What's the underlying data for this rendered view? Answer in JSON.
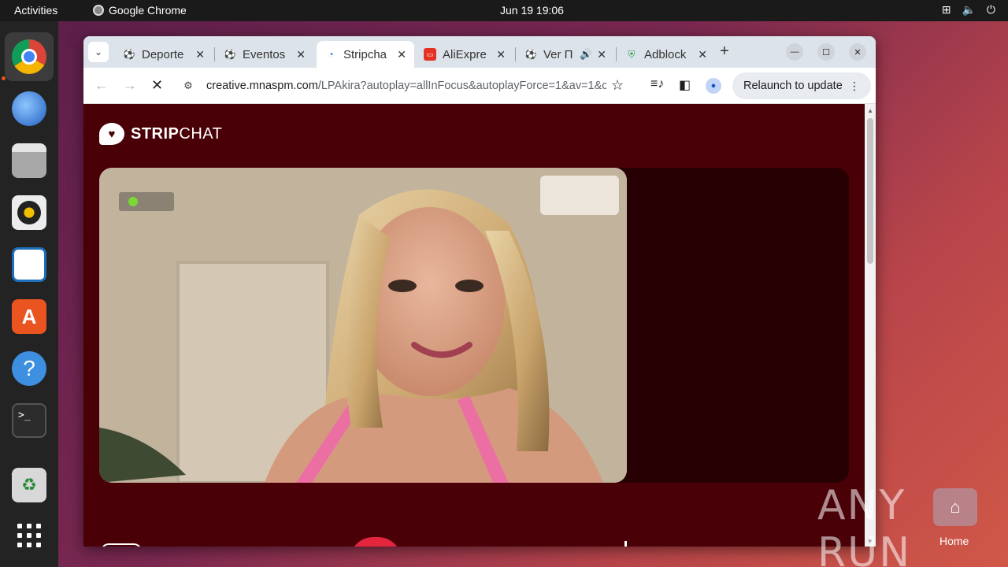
{
  "topbar": {
    "activities": "Activities",
    "app_name": "Google Chrome",
    "datetime": "Jun 19  19:06"
  },
  "tabs": [
    {
      "title": "Deporte",
      "favicon": "soccer-ball-icon"
    },
    {
      "title": "Eventos",
      "favicon": "soccer-ball-icon"
    },
    {
      "title": "Stripcha",
      "favicon": "loading-spinner-icon",
      "active": true
    },
    {
      "title": "AliExpre",
      "favicon": "aliexpress-icon"
    },
    {
      "title": "Ver Π",
      "favicon": "soccer-ball-icon",
      "audio": true
    },
    {
      "title": "Adblock",
      "favicon": "shield-icon"
    }
  ],
  "omnibox": {
    "url_host": "creative.mnaspm.com",
    "url_path": "/LPAkira?autoplay=allInFocus&autoplayForce=1&av=1&c..."
  },
  "toolbar": {
    "relaunch_label": "Relaunch to update"
  },
  "page": {
    "logo_bold": "STRIP",
    "logo_regular": "CHAT"
  },
  "watermark": "ANY RUN",
  "desktop": {
    "home_label": "Home"
  },
  "colors": {
    "page_background": "#4a0007",
    "player_background": "#270003",
    "live_indicator": "#7bd934",
    "accent_heart": "#e3263d",
    "ubuntu_orange": "#e95420"
  }
}
